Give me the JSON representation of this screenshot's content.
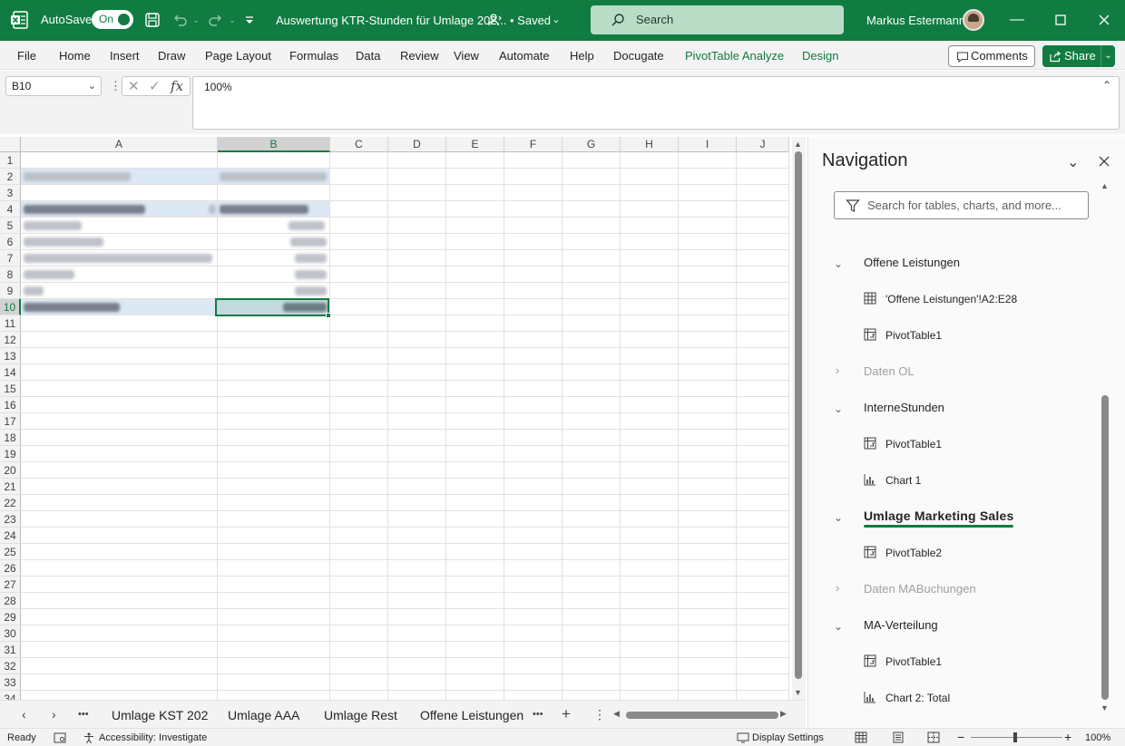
{
  "titlebar": {
    "autosave_label": "AutoSave",
    "autosave_state": "On",
    "doc_title": "Auswertung KTR-Stunden für Umlage 202...",
    "saved_status": "• Saved",
    "search_placeholder": "Search",
    "user_name": "Markus Estermann"
  },
  "ribbon": {
    "tabs": [
      "File",
      "Home",
      "Insert",
      "Draw",
      "Page Layout",
      "Formulas",
      "Data",
      "Review",
      "View",
      "Automate",
      "Help",
      "Docugate",
      "PivotTable Analyze",
      "Design"
    ],
    "comments_label": "Comments",
    "share_label": "Share"
  },
  "formula_bar": {
    "name_box": "B10",
    "fx_label": "fx",
    "formula_value": "100%"
  },
  "grid": {
    "columns": [
      "A",
      "B",
      "C",
      "D",
      "E",
      "F",
      "G",
      "H",
      "I",
      "J"
    ],
    "rows": [
      "1",
      "2",
      "3",
      "4",
      "5",
      "6",
      "7",
      "8",
      "9",
      "10",
      "11",
      "12",
      "13",
      "14",
      "15",
      "16",
      "17",
      "18",
      "19",
      "20",
      "21",
      "22",
      "23",
      "24",
      "25",
      "26",
      "27",
      "28",
      "29",
      "30",
      "31",
      "32",
      "33",
      "34"
    ],
    "selected_column": "B",
    "selected_row": "10"
  },
  "sheet_tabs": {
    "tabs": [
      "Umlage KST 202",
      "Umlage AAA",
      "Umlage Rest",
      "Offene Leistungen"
    ],
    "more_glyph": "•••",
    "add_glyph": "+"
  },
  "statusbar": {
    "ready": "Ready",
    "accessibility": "Accessibility: Investigate",
    "display_settings": "Display Settings",
    "zoom": "100%"
  },
  "navigation": {
    "title": "Navigation",
    "search_placeholder": "Search for tables, charts, and more...",
    "groups": [
      {
        "label": "Offene Leistungen",
        "expanded": true,
        "items": [
          {
            "label": "'Offene Leistungen'!A2:E28",
            "icon": "range-icon"
          },
          {
            "label": "PivotTable1",
            "icon": "pivottable-icon"
          }
        ]
      },
      {
        "label": "Daten OL",
        "expanded": false,
        "dim": true,
        "items": []
      },
      {
        "label": "InterneStunden",
        "expanded": true,
        "items": [
          {
            "label": "PivotTable1",
            "icon": "pivottable-icon"
          },
          {
            "label": "Chart 1",
            "icon": "chart-icon"
          }
        ]
      },
      {
        "label": "Umlage Marketing Sales",
        "expanded": true,
        "active": true,
        "items": [
          {
            "label": "PivotTable2",
            "icon": "pivottable-icon"
          }
        ]
      },
      {
        "label": "Daten MABuchungen",
        "expanded": false,
        "dim": true,
        "items": []
      },
      {
        "label": "MA-Verteilung",
        "expanded": true,
        "items": [
          {
            "label": "PivotTable1",
            "icon": "pivottable-icon"
          },
          {
            "label": "Chart 2: Total",
            "icon": "chart-icon"
          }
        ]
      }
    ]
  },
  "colors": {
    "accent": "#107c41",
    "ribbon_bg": "#f3f3f3",
    "pivot_band": "#dde8f5"
  }
}
